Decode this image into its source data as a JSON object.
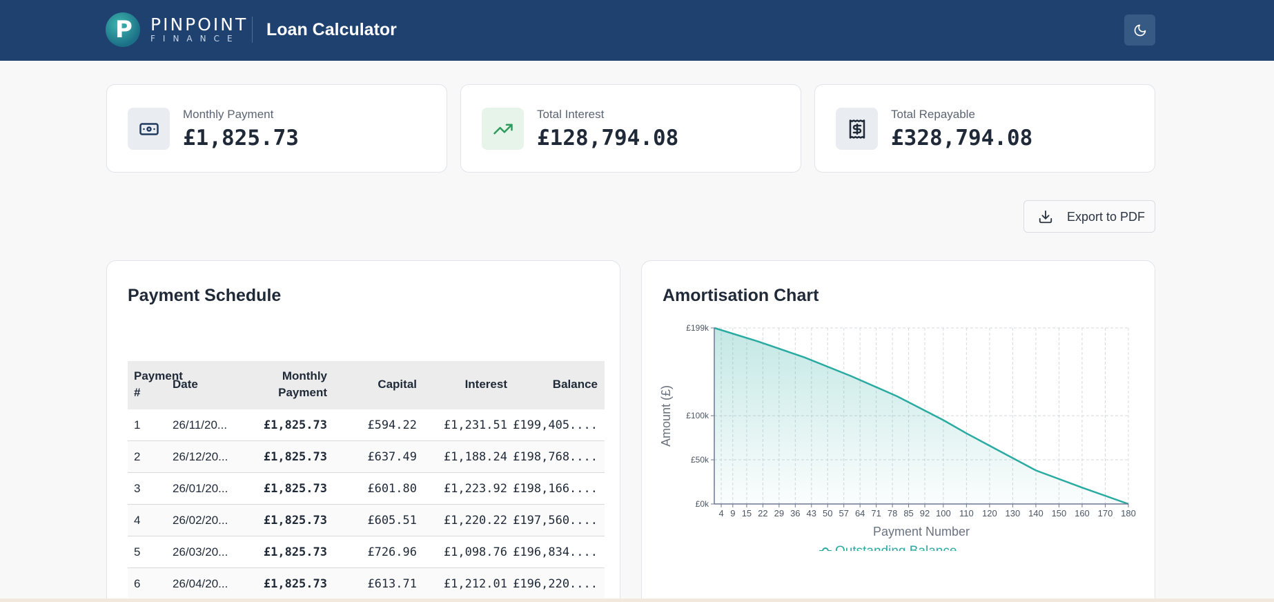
{
  "header": {
    "brand_primary": "PINPOINT",
    "brand_secondary": "FINANCE",
    "logo_letter": "P",
    "title": "Loan Calculator",
    "theme_toggle_icon": "moon-icon"
  },
  "summary": [
    {
      "label": "Monthly Payment",
      "value": "£1,825.73",
      "icon": "banknote-icon",
      "icon_bg": "#e9ecf1",
      "icon_color": "#1e3a5f"
    },
    {
      "label": "Total Interest",
      "value": "£128,794.08",
      "icon": "trending-up-icon",
      "icon_bg": "#e6f4ea",
      "icon_color": "#2e9b5e"
    },
    {
      "label": "Total Repayable",
      "value": "£328,794.08",
      "icon": "receipt-icon",
      "icon_bg": "#e9ecf1",
      "icon_color": "#1f2937"
    }
  ],
  "export": {
    "label": "Export to PDF",
    "icon": "download-icon"
  },
  "schedule": {
    "title": "Payment Schedule",
    "headers": {
      "payment_no": [
        "Payment",
        "#"
      ],
      "date": "Date",
      "monthly": [
        "Monthly",
        "Payment"
      ],
      "capital": "Capital",
      "interest": "Interest",
      "balance": "Balance"
    },
    "rows": [
      {
        "no": "1",
        "date": "26/11/20...",
        "monthly": "£1,825.73",
        "capital": "£594.22",
        "interest": "£1,231.51",
        "balance": "£199,405...."
      },
      {
        "no": "2",
        "date": "26/12/20...",
        "monthly": "£1,825.73",
        "capital": "£637.49",
        "interest": "£1,188.24",
        "balance": "£198,768...."
      },
      {
        "no": "3",
        "date": "26/01/20...",
        "monthly": "£1,825.73",
        "capital": "£601.80",
        "interest": "£1,223.92",
        "balance": "£198,166...."
      },
      {
        "no": "4",
        "date": "26/02/20...",
        "monthly": "£1,825.73",
        "capital": "£605.51",
        "interest": "£1,220.22",
        "balance": "£197,560...."
      },
      {
        "no": "5",
        "date": "26/03/20...",
        "monthly": "£1,825.73",
        "capital": "£726.96",
        "interest": "£1,098.76",
        "balance": "£196,834...."
      },
      {
        "no": "6",
        "date": "26/04/20...",
        "monthly": "£1,825.73",
        "capital": "£613.71",
        "interest": "£1,212.01",
        "balance": "£196,220...."
      }
    ]
  },
  "chart": {
    "title": "Amortisation Chart",
    "legend_icon": "line-marker-icon"
  },
  "chart_data": {
    "type": "area",
    "xlabel": "Payment Number",
    "ylabel": "Amount (£)",
    "x_ticks": [
      "4",
      "9",
      "15",
      "22",
      "29",
      "36",
      "43",
      "50",
      "57",
      "64",
      "71",
      "78",
      "85",
      "92",
      "100",
      "110",
      "120",
      "130",
      "140",
      "150",
      "160",
      "170",
      "180"
    ],
    "y_ticks": [
      {
        "label": "£0k",
        "value": 0
      },
      {
        "label": "£50k",
        "value": 50000
      },
      {
        "label": "£100k",
        "value": 100000
      },
      {
        "label": "£199k",
        "value": 199405
      }
    ],
    "xlim": [
      1,
      180
    ],
    "ylim": [
      0,
      199405
    ],
    "grid": true,
    "legend_placement": "bottom",
    "series": [
      {
        "name": "Outstanding Balance",
        "color": "#2aaba1",
        "x": [
          1,
          20,
          40,
          60,
          80,
          100,
          110,
          120,
          140,
          160,
          180
        ],
        "y": [
          199405,
          184000,
          166000,
          145000,
          122000,
          95000,
          80000,
          66000,
          38000,
          18500,
          0
        ]
      }
    ]
  }
}
